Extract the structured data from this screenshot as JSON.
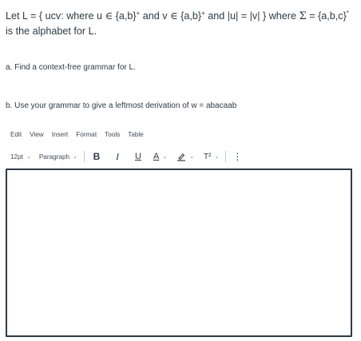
{
  "question": {
    "line1_part1": "Let L = { ucv:  where  u",
    "elem1": "∈",
    "set1": "{a,b}",
    "sup1": "+",
    "and_v": " and v",
    "elem2": "∈",
    "set2": "{a,b}",
    "sup2": "+",
    "and_len": " and |u|  = |v| } where",
    "sigma": "Σ",
    "sigma_def": " = {a,b,c}",
    "sup3": "*",
    "is_the": " is the alphabet for L."
  },
  "part_a": "a. Find a  context-free grammar for L.",
  "part_b": "b.  Use your grammar to give a leftmost derivation of w = abacaab",
  "menubar": [
    "Edit",
    "View",
    "Insert",
    "Format",
    "Tools",
    "Table"
  ],
  "toolbar": {
    "font_size": "12pt",
    "block_format": "Paragraph",
    "bold": "B",
    "italic": "I",
    "underline": "U",
    "text_color": "A",
    "superscript": "T²",
    "more": "⋮",
    "chevron": "⌄"
  },
  "editor": {
    "value": ""
  }
}
